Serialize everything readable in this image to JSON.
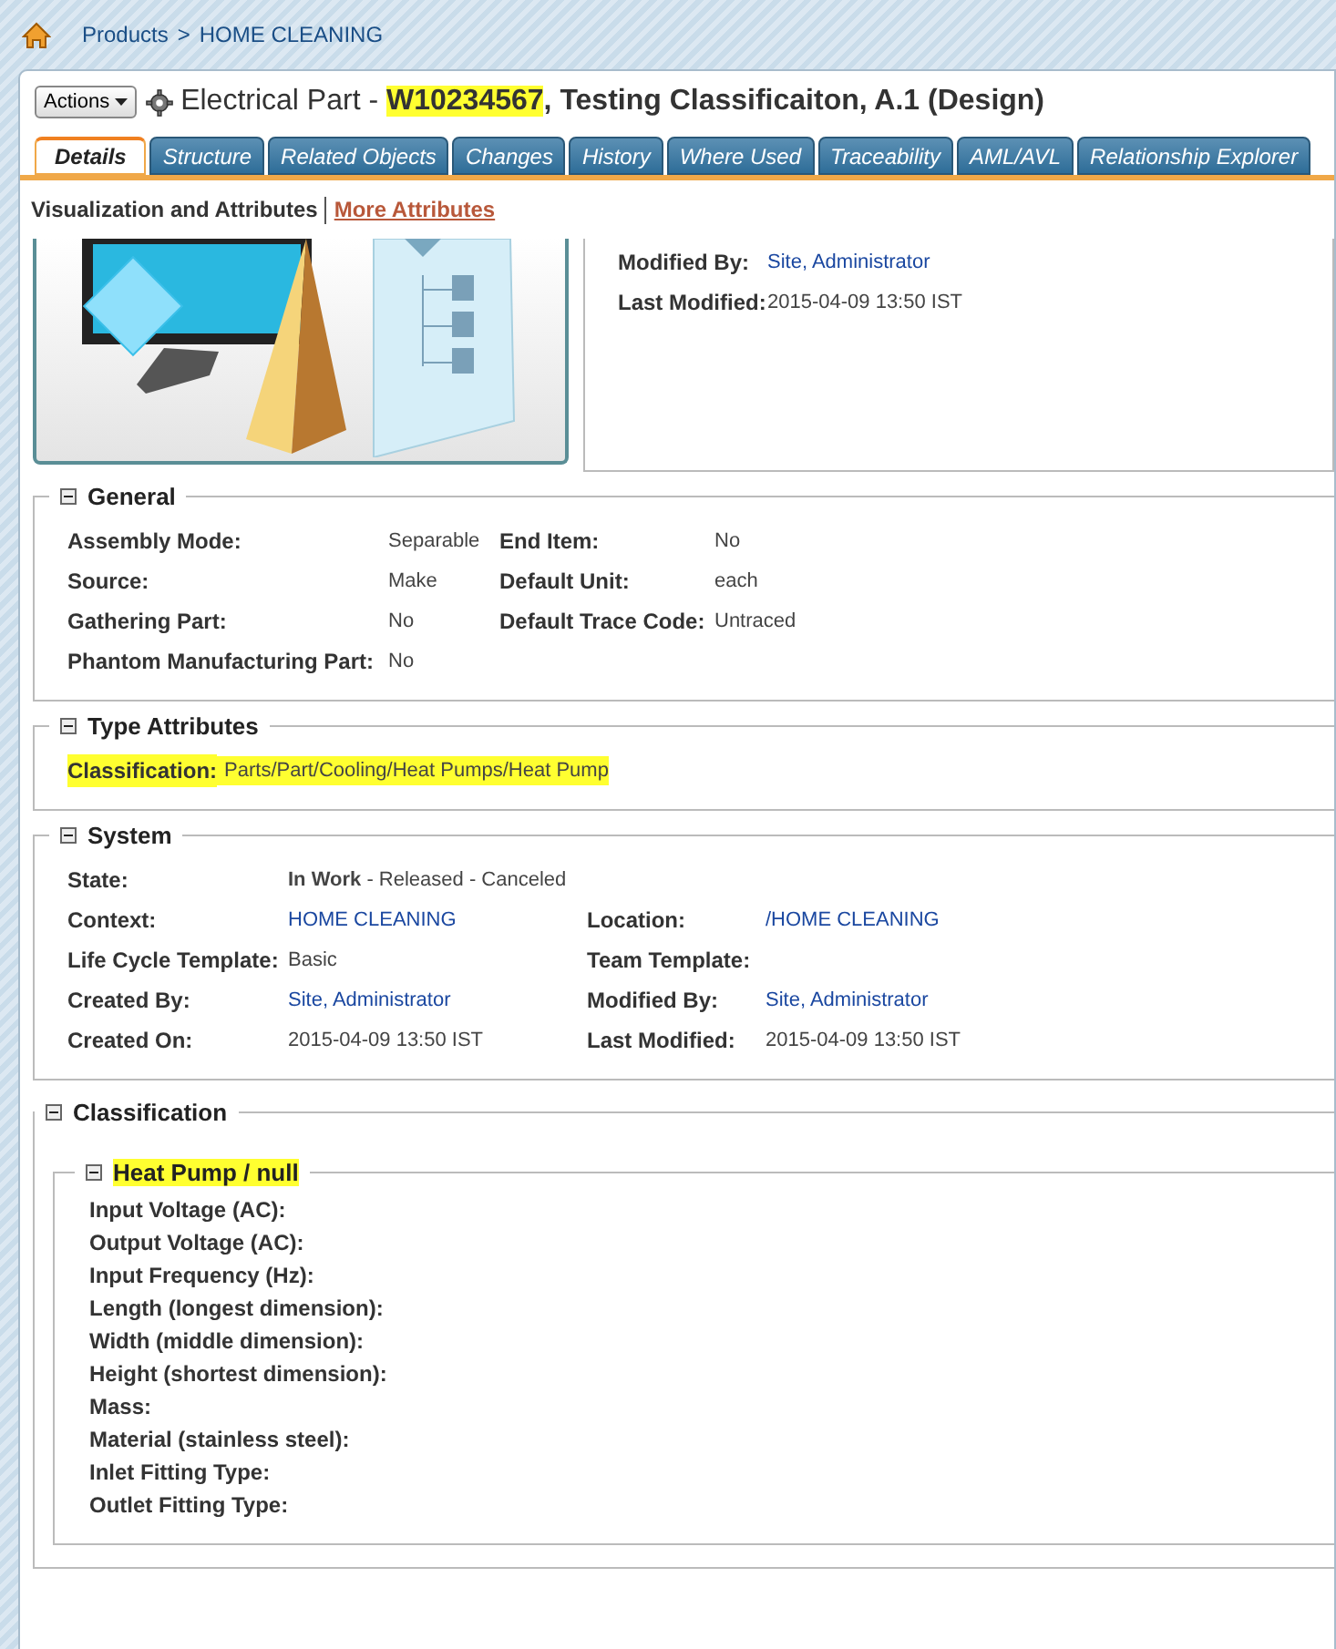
{
  "breadcrumb": {
    "items": [
      "Products",
      "HOME CLEANING"
    ],
    "separator": ">"
  },
  "header": {
    "actions_label": "Actions",
    "title_parts": [
      {
        "text": "Electrical Part - ",
        "highlighted": false,
        "bold": false
      },
      {
        "text": "W10234567",
        "highlighted": true,
        "bold": true
      },
      {
        "text": ", Testing Classificaiton, A.1 (Design)",
        "highlighted": false,
        "bold": true
      }
    ]
  },
  "tabs": [
    {
      "label": "Details",
      "selected": true
    },
    {
      "label": "Structure",
      "selected": false
    },
    {
      "label": "Related Objects",
      "selected": false
    },
    {
      "label": "Changes",
      "selected": false
    },
    {
      "label": "History",
      "selected": false
    },
    {
      "label": "Where Used",
      "selected": false
    },
    {
      "label": "Traceability",
      "selected": false
    },
    {
      "label": "AML/AVL",
      "selected": false
    },
    {
      "label": "Relationship Explorer",
      "selected": false
    }
  ],
  "subnav": [
    {
      "label": "Visualization and Attributes",
      "selected": true
    },
    {
      "label": "More Attributes",
      "selected": false
    }
  ],
  "summary": [
    {
      "label": "Modified By:",
      "value": "Site, Administrator",
      "link": true
    },
    {
      "label": "Last Modified:",
      "value": "2015-04-09 13:50 IST",
      "link": false
    }
  ],
  "sections": [
    {
      "title": "General",
      "kind": "grid",
      "rows": [
        [
          {
            "label": "Assembly Mode:",
            "value": "Separable",
            "link": false,
            "highlighted": false
          },
          {
            "label": "End Item:",
            "value": "No",
            "link": false,
            "highlighted": false
          }
        ],
        [
          {
            "label": "Source:",
            "value": "Make",
            "link": false,
            "highlighted": false
          },
          {
            "label": "Default Unit:",
            "value": "each",
            "link": false,
            "highlighted": false
          }
        ],
        [
          {
            "label": "Gathering Part:",
            "value": "No",
            "link": false,
            "highlighted": false
          },
          {
            "label": "Default Trace Code:",
            "value": "Untraced",
            "link": false,
            "highlighted": false
          }
        ],
        [
          {
            "label": "Phantom Manufacturing Part:",
            "value": "No",
            "link": false,
            "highlighted": false
          }
        ]
      ]
    },
    {
      "title": "Type Attributes",
      "kind": "single",
      "rows": [
        [
          {
            "label": "Classification:",
            "value": "Parts/Part/Cooling/Heat Pumps/Heat Pump",
            "link": false,
            "highlighted": true
          }
        ]
      ]
    },
    {
      "title": "System",
      "kind": "grid",
      "rows": [
        [
          {
            "label": "State:",
            "value": "**In Work** - Released - Canceled",
            "link": false,
            "highlighted": false
          }
        ],
        [
          {
            "label": "Context:",
            "value": "HOME CLEANING",
            "link": true,
            "highlighted": false
          },
          {
            "label": "Location:",
            "value": "/HOME CLEANING",
            "link": true,
            "highlighted": false
          }
        ],
        [
          {
            "label": "Life Cycle Template:",
            "value": "Basic",
            "link": false,
            "highlighted": false
          },
          {
            "label": "Team Template:",
            "highlighted": false
          }
        ],
        [
          {
            "label": "Created By:",
            "value": "Site, Administrator",
            "link": true,
            "highlighted": false
          },
          {
            "label": "Modified By:",
            "value": "Site, Administrator",
            "link": true,
            "highlighted": false
          }
        ],
        [
          {
            "label": "Created On:",
            "value": "2015-04-09 13:50 IST",
            "link": false,
            "highlighted": false
          },
          {
            "label": "Last Modified:",
            "value": "2015-04-09 13:50 IST",
            "link": false,
            "highlighted": false
          }
        ]
      ]
    },
    {
      "title": "Classification",
      "kind": "nested",
      "sub": {
        "title": "Heat Pump / null",
        "highlighted": true,
        "labels": [
          "Input Voltage (AC):",
          "Output Voltage (AC):",
          "Input Frequency (Hz):",
          "Length (longest dimension):",
          "Width (middle dimension):",
          "Height (shortest dimension):",
          "Mass:",
          "Material (stainless steel):",
          "Inlet Fitting Type:",
          "Outlet Fitting Type:"
        ]
      }
    }
  ]
}
